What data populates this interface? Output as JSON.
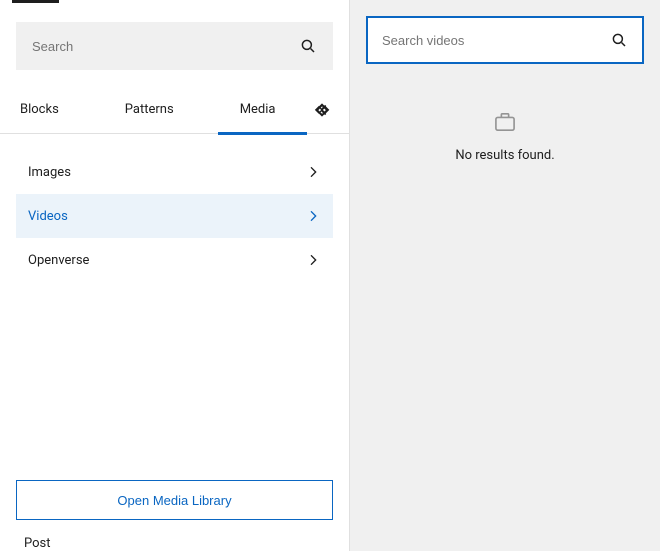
{
  "left": {
    "search": {
      "placeholder": "Search"
    },
    "tabs": {
      "blocks": "Blocks",
      "patterns": "Patterns",
      "media": "Media"
    },
    "categories": {
      "images": "Images",
      "videos": "Videos",
      "openverse": "Openverse"
    },
    "openLibrary": "Open Media Library",
    "post": "Post"
  },
  "right": {
    "search": {
      "placeholder": "Search videos"
    },
    "empty": "No results found."
  }
}
